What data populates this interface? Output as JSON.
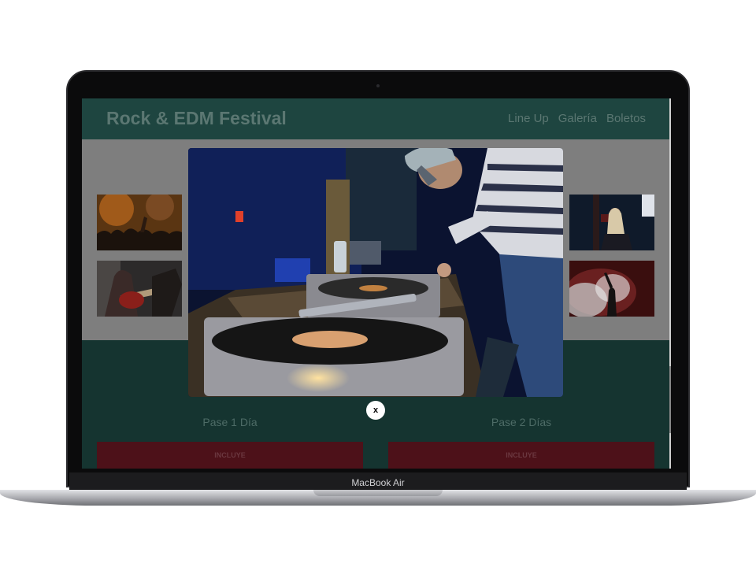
{
  "device": {
    "label": "MacBook Air"
  },
  "site": {
    "title": "Rock & EDM Festival",
    "nav": [
      "Line Up",
      "Galería",
      "Boletos"
    ]
  },
  "passes": [
    {
      "name": "Pase 1 Día",
      "button": "INCLUYE"
    },
    {
      "name": "Pase 2 Días",
      "button": "INCLUYE"
    }
  ],
  "modal": {
    "close_label": "x"
  },
  "colors": {
    "header": "#1e4540",
    "pass_button": "#4d1119",
    "overlay": "#7e7e7e"
  }
}
